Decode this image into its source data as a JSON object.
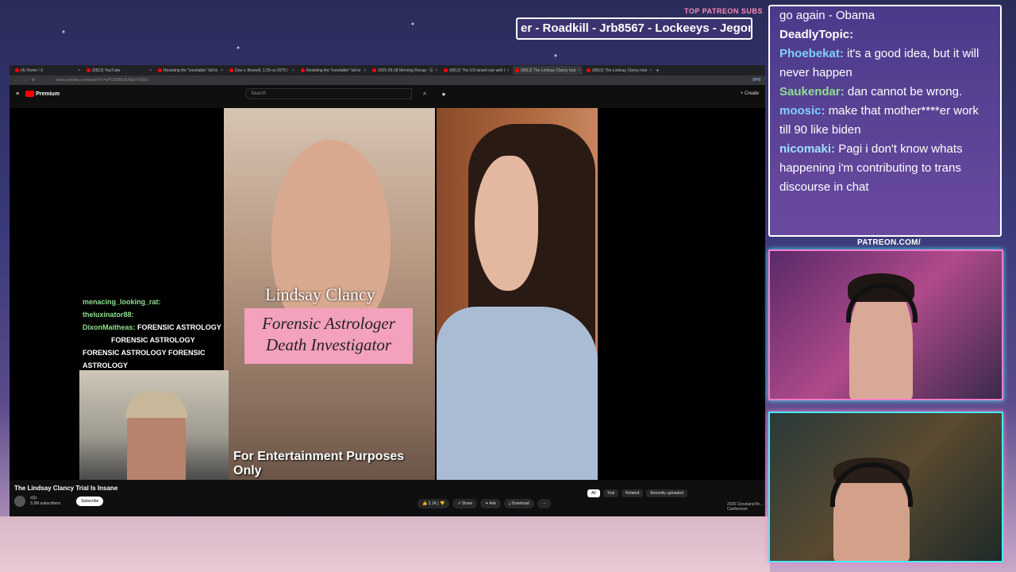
{
  "patreon": {
    "title": "TOP PATREON SUBS",
    "ticker": "er - Roadkill - Jrb8567 - Lockeeys - Jegon"
  },
  "browser": {
    "tabs": [
      "(4) Home / X",
      "(9813) YouTube",
      "Resisting the \"inevitable\" fall to",
      "Doe v. Bonnell, 1:25-cv-2075 /",
      "Resisting the \"inevitable\" fall to",
      "2025-06-28 Morning Recap - G",
      "(9813) The US-Israeli war with I",
      "(9813) The Lindsay Clancy trial",
      "(9813) The Lindsay Clancy trial"
    ],
    "active_tab": 7,
    "url": "www.youtube.com/watch?v=xPC8SBIs2U8&t=1655s",
    "vpn": "VPN"
  },
  "youtube": {
    "logo": "Premium",
    "search_placeholder": "Search",
    "create": "Create",
    "video_title": "The Lindsay Clancy Trial Is Insane",
    "channel": "xQc",
    "subscribers": "3.3M subscribers",
    "subscribe": "Subscribe",
    "actions": {
      "like": "2.1K",
      "share": "Share",
      "ask": "Ask",
      "download": "Download"
    },
    "chips": [
      "All",
      "Trial",
      "Related",
      "Recently uploaded"
    ],
    "recommended": "2026 Cleveland Br... Conference"
  },
  "video": {
    "name": "Lindsay Clancy",
    "box_line1": "Forensic Astrologer",
    "box_line2": "Death Investigator",
    "caption": "For Entertainment Purposes Only"
  },
  "overlay_chat": [
    {
      "user": "menacing_looking_rat:",
      "text": ""
    },
    {
      "user": "theluxinator88:",
      "text": ""
    },
    {
      "user": "DixonMaitheas:",
      "text": "FORENSIC ASTROLOGY"
    },
    {
      "user": "",
      "text": "FORENSIC ASTROLOGY"
    },
    {
      "user": "",
      "text": "FORENSIC ASTROLOGY FORENSIC"
    },
    {
      "user": "",
      "text": "ASTROLOGY"
    }
  ],
  "chat": [
    {
      "user": "",
      "text": "go again - Obama",
      "color": "#8fd8ff"
    },
    {
      "user": "DeadlyTopic:",
      "text": "",
      "color": "#ffffff"
    },
    {
      "user": "Phoebekat:",
      "text": "it's a good idea, but it will never happen",
      "color": "#7fd0ff"
    },
    {
      "user": "Saukendar:",
      "text": "dan cannot be wrong.",
      "color": "#8fe08f"
    },
    {
      "user": "moosic:",
      "text": "make that mother****er work till 90 like biden",
      "color": "#7fd0ff"
    },
    {
      "user": "nicomaki:",
      "text": "Pagi i don't know whats happening i'm contributing to trans discourse in chat",
      "color": "#9fe0ff"
    }
  ],
  "patreon_url": "PATREON.COM/"
}
